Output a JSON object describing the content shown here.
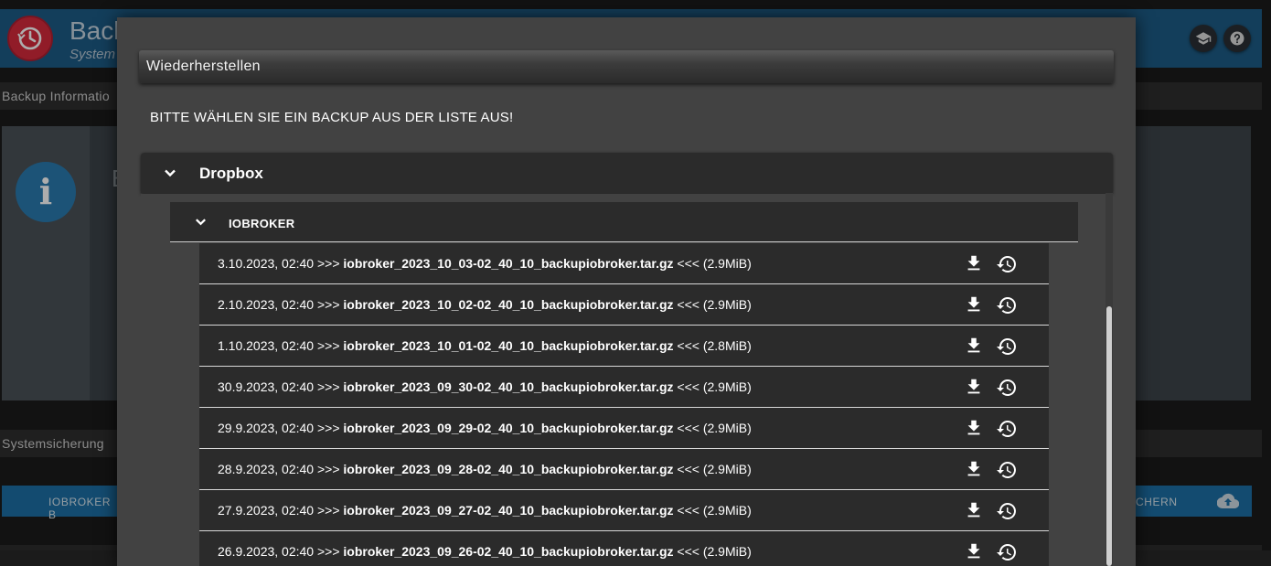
{
  "app": {
    "title": "Backup",
    "subtitle": "System",
    "header_icons": [
      "graduation-cap-icon",
      "help-icon"
    ],
    "sections": {
      "backup_information": "Backup Informatio",
      "systemsicherung": "Systemsicherung"
    },
    "buttons": {
      "iobroker_backup": "IOBROKER B",
      "save_right": "CHERN"
    },
    "info_partial_letter": "B"
  },
  "dialog": {
    "title": "Wiederherstellen",
    "instruction": "BITTE WÄHLEN SIE EIN BACKUP AUS DER LISTE AUS!",
    "source": {
      "name": "Dropbox",
      "expanded": true,
      "group": {
        "name": "IOBROKER",
        "expanded": true,
        "items": [
          {
            "date": "3.10.2023, 02:40",
            "file": "iobroker_2023_10_03-02_40_10_backupiobroker.tar.gz",
            "size": "(2.9MiB)"
          },
          {
            "date": "2.10.2023, 02:40",
            "file": "iobroker_2023_10_02-02_40_10_backupiobroker.tar.gz",
            "size": "(2.9MiB)"
          },
          {
            "date": "1.10.2023, 02:40",
            "file": "iobroker_2023_10_01-02_40_10_backupiobroker.tar.gz",
            "size": "(2.8MiB)"
          },
          {
            "date": "30.9.2023, 02:40",
            "file": "iobroker_2023_09_30-02_40_10_backupiobroker.tar.gz",
            "size": "(2.9MiB)"
          },
          {
            "date": "29.9.2023, 02:40",
            "file": "iobroker_2023_09_29-02_40_10_backupiobroker.tar.gz",
            "size": "(2.9MiB)"
          },
          {
            "date": "28.9.2023, 02:40",
            "file": "iobroker_2023_09_28-02_40_10_backupiobroker.tar.gz",
            "size": "(2.9MiB)"
          },
          {
            "date": "27.9.2023, 02:40",
            "file": "iobroker_2023_09_27-02_40_10_backupiobroker.tar.gz",
            "size": "(2.9MiB)"
          },
          {
            "date": "26.9.2023, 02:40",
            "file": "iobroker_2023_09_26-02_40_10_backupiobroker.tar.gz",
            "size": "(2.9MiB)"
          }
        ]
      }
    },
    "row_prefix": ">>>",
    "row_suffix": "<<<",
    "row_icons": [
      "download-icon",
      "restore-icon"
    ]
  }
}
